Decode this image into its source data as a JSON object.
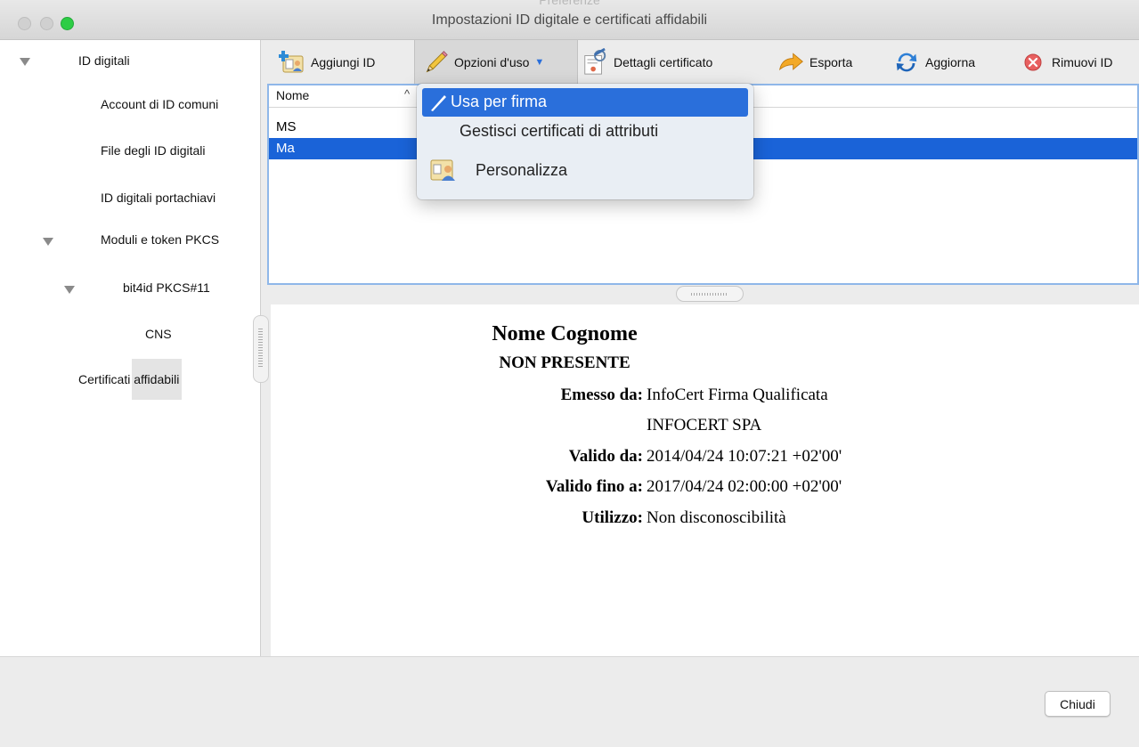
{
  "window": {
    "ghost_title": "Preferenze",
    "title": "Impostazioni ID digitale e certificati affidabili"
  },
  "sidebar": {
    "items": [
      {
        "label": "ID digitali"
      },
      {
        "label": "Account di ID comuni"
      },
      {
        "label": "File degli ID digitali"
      },
      {
        "label": "ID digitali portachiavi"
      },
      {
        "label": "Moduli e token PKCS"
      },
      {
        "label": "bit4id PKCS#11"
      },
      {
        "label": "CNS"
      },
      {
        "label": "Certificati affidabili"
      }
    ]
  },
  "toolbar": {
    "add_id": "Aggiungi ID",
    "usage_options": "Opzioni d'uso",
    "cert_details": "Dettagli certificato",
    "export": "Esporta",
    "refresh": "Aggiorna",
    "remove_id": "Rimuovi ID"
  },
  "table": {
    "column_name": "Nome",
    "sort_indicator": "^",
    "rows": [
      "MS",
      "Ma"
    ]
  },
  "menu": {
    "items": [
      {
        "label": "Usa per firma"
      },
      {
        "label": "Gestisci certificati di attributi"
      },
      {
        "label": "Personalizza"
      }
    ]
  },
  "details": {
    "name": "Nome Cognome",
    "org": "NON PRESENTE",
    "issued_by_label": "Emesso da:",
    "issued_by": "InfoCert Firma Qualificata",
    "issuer_org": "INFOCERT SPA",
    "valid_from_label": "Valido da:",
    "valid_from": "2014/04/24 10:07:21 +02'00'",
    "valid_to_label": "Valido fino a:",
    "valid_to": "2017/04/24 02:00:00 +02'00'",
    "usage_label": "Utilizzo:",
    "usage": "Non disconoscibilità"
  },
  "footer": {
    "close": "Chiudi"
  },
  "colors": {
    "selection": "#1a63d8",
    "menu_highlight": "#2a6fdb",
    "traffic_green": "#2dcd45"
  }
}
